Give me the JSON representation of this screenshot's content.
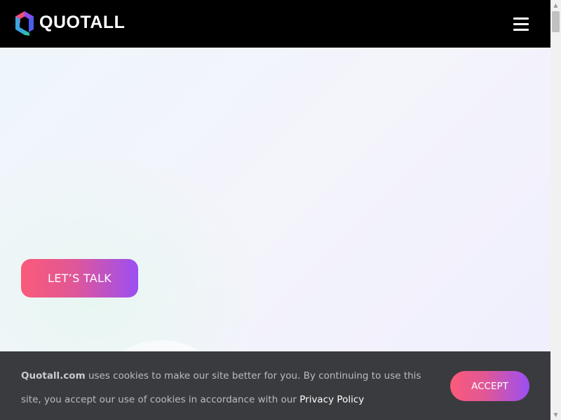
{
  "header": {
    "brand": "QUOTALL",
    "logo_icon": "quotall-hexagon-logo",
    "menu_icon": "hamburger-menu-icon"
  },
  "hero": {
    "cta_label": "LET’S TALK"
  },
  "cookie_banner": {
    "brand": "Quotall.com",
    "text_1": " uses cookies to make our site better for you. By continuing to use this site, you accept our use of cookies in accordance with our ",
    "policy_link": "Privacy Policy",
    "accept_label": "ACCEPT"
  },
  "colors": {
    "header_bg": "#000000",
    "cta_gradient_start": "#fb5a79",
    "cta_gradient_end": "#9b4ff3",
    "cookie_bg": "#3a3b3e"
  }
}
